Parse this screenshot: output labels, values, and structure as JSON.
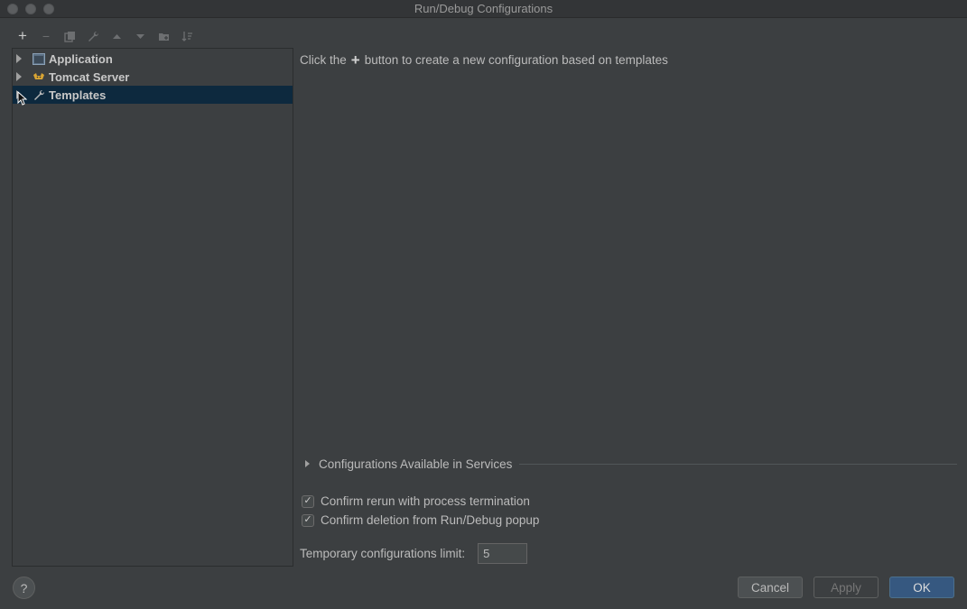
{
  "window": {
    "title": "Run/Debug Configurations"
  },
  "toolbar": {
    "buttons": [
      "add",
      "remove",
      "copy",
      "edit-defaults",
      "move-up",
      "move-down",
      "create-folder",
      "sort"
    ]
  },
  "tree": {
    "items": [
      {
        "label": "Application",
        "icon": "application-icon"
      },
      {
        "label": "Tomcat Server",
        "icon": "tomcat-icon"
      },
      {
        "label": "Templates",
        "icon": "wrench-icon",
        "selected": true
      }
    ]
  },
  "main": {
    "hint_before": "Click the",
    "hint_after": "button to create a new configuration based on templates",
    "services_label": "Configurations Available in Services",
    "confirm_rerun_label": "Confirm rerun with process termination",
    "confirm_rerun_checked": true,
    "confirm_deletion_label": "Confirm deletion from Run/Debug popup",
    "confirm_deletion_checked": true,
    "temp_limit_label": "Temporary configurations limit:",
    "temp_limit_value": "5"
  },
  "footer": {
    "help_label": "?",
    "cancel_label": "Cancel",
    "apply_label": "Apply",
    "ok_label": "OK"
  },
  "colors": {
    "background": "#3c3f41",
    "selection": "#0d293e",
    "primary_button": "#365880"
  }
}
